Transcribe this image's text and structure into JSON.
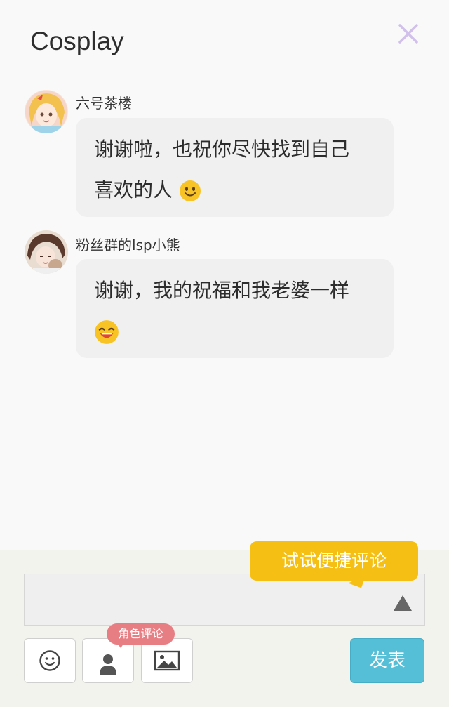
{
  "header": {
    "title": "Cosplay",
    "close_icon": "close-icon",
    "close_color": "#d0c0ea"
  },
  "comments": [
    {
      "username": "六号茶楼",
      "text_line1": "谢谢啦，也祝你尽快找到自己",
      "text_line2": "喜欢的人",
      "emoji": "smile-emoji"
    },
    {
      "username": "粉丝群的lsp小熊",
      "text_line1": "谢谢，我的祝福和我老婆一样",
      "emoji": "grin-emoji"
    }
  ],
  "composer": {
    "input_value": "",
    "tooltip": "试试便捷评论",
    "expand_icon": "triangle-up-icon",
    "role_badge": "角色评论",
    "emoji_button_icon": "emoji-icon",
    "role_button_icon": "person-icon",
    "image_button_icon": "image-icon",
    "send_label": "发表"
  },
  "colors": {
    "tooltip_bg": "#f6bf13",
    "badge_bg": "#e77e83",
    "send_bg": "#56bfd8"
  }
}
